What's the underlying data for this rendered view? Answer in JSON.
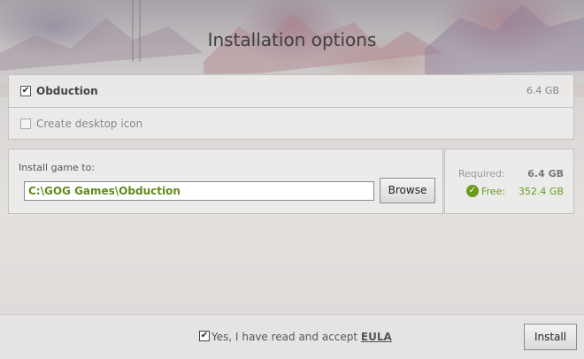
{
  "header": {
    "title": "Installation options"
  },
  "game": {
    "name": "Obduction",
    "size": "6.4 GB",
    "checked": true
  },
  "desktop_icon": {
    "label": "Create desktop icon",
    "checked": false
  },
  "install": {
    "label": "Install game to:",
    "path": "C:\\GOG Games\\Obduction",
    "browse_label": "Browse"
  },
  "space": {
    "required_label": "Required:",
    "required_value": "6.4 GB",
    "free_label": "Free:",
    "free_value": "352.4 GB",
    "ok_color": "#6a9c1f"
  },
  "footer": {
    "eula_prefix": "Yes, I have read and accept ",
    "eula_link": "EULA",
    "eula_checked": true,
    "install_label": "Install"
  },
  "icons": {
    "check": "✔",
    "checkmark": "✓"
  }
}
